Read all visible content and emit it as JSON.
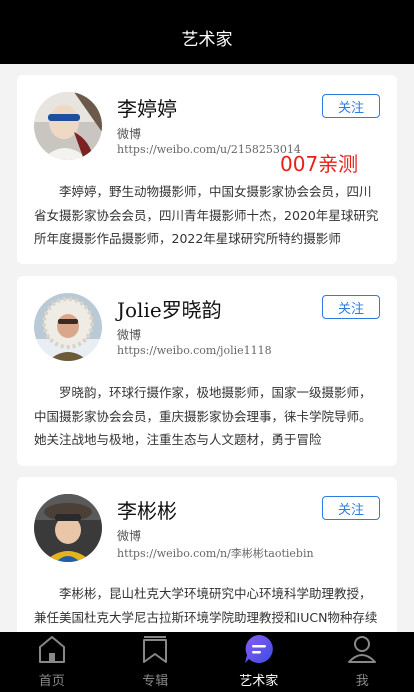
{
  "header": {
    "title": "艺术家"
  },
  "watermark": "007亲测",
  "artists": [
    {
      "name": "李婷婷",
      "follow_label": "关注",
      "platform": "微博",
      "url": "https://weibo.com/u/2158253014",
      "bio": "李婷婷，野生动物摄影师，中国女摄影家协会会员，四川省女摄影家协会会员，四川青年摄影师十杰，2020年星球研究所年度摄影作品摄影师，2022年星球研究所特约摄影师"
    },
    {
      "name": "Jolie罗晓韵",
      "follow_label": "关注",
      "platform": "微博",
      "url": "https://weibo.com/jolie1118",
      "bio": "罗晓韵，环球行摄作家，极地摄影师，国家一级摄影师，中国摄影家协会会员，重庆摄影家协会理事，徕卡学院导师。她关注战地与极地，注重生态与人文题材，勇于冒险"
    },
    {
      "name": "李彬彬",
      "follow_label": "关注",
      "platform": "微博",
      "url": "https://weibo.com/n/李彬彬taotiebin",
      "bio": "李彬彬，昆山杜克大学环境研究中心环境科学助理教授，兼任美国杜克大学尼古拉斯环境学院助理教授和IUCN物种存续委员会成员"
    }
  ],
  "tabbar": {
    "items": [
      {
        "label": "首页",
        "icon": "home-icon"
      },
      {
        "label": "专辑",
        "icon": "bookmark-icon"
      },
      {
        "label": "艺术家",
        "icon": "artist-chat-icon"
      },
      {
        "label": "我",
        "icon": "user-icon"
      }
    ],
    "active_index": 2
  },
  "colors": {
    "accent": "#2f7be0",
    "watermark": "#e8211a",
    "active_tab": "#6a4cf0"
  }
}
